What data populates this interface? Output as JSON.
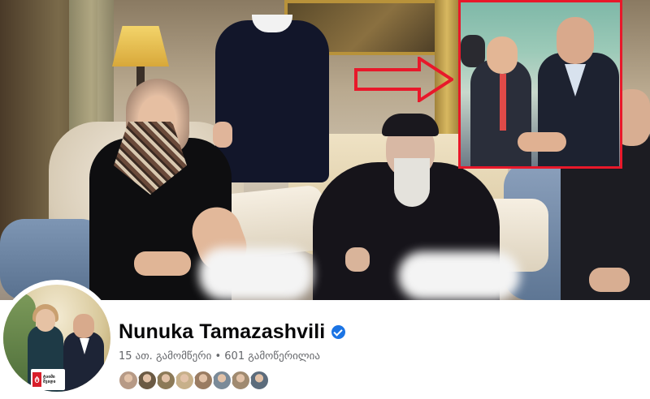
{
  "profile": {
    "name": "Nunuka Tamazashvili",
    "verified": true,
    "following_count": "15 ათ. გამომწერი",
    "separator": "•",
    "followers_count": "601 გამოწერილია",
    "avatar_logo": {
      "mark": "ტ",
      "line1": "ტაიმი",
      "line2": "შვიდი"
    }
  },
  "friends": [
    {
      "name": "friend-1",
      "color": "#b79a86"
    },
    {
      "name": "friend-2",
      "color": "#6b5a44"
    },
    {
      "name": "friend-3",
      "color": "#8c7a58"
    },
    {
      "name": "friend-4",
      "color": "#c7b08a"
    },
    {
      "name": "friend-5",
      "color": "#9a7c62"
    },
    {
      "name": "friend-6",
      "color": "#7a8a98"
    },
    {
      "name": "friend-7",
      "color": "#a08a70"
    },
    {
      "name": "friend-8",
      "color": "#5c6c7c"
    }
  ],
  "colors": {
    "accent_red": "#e8182a",
    "verified_blue": "#1b74e4",
    "name_text": "#080809",
    "meta_text": "#65676b"
  },
  "icons": {
    "verified": "verified-badge-icon",
    "arrow": "red-arrow-icon"
  }
}
